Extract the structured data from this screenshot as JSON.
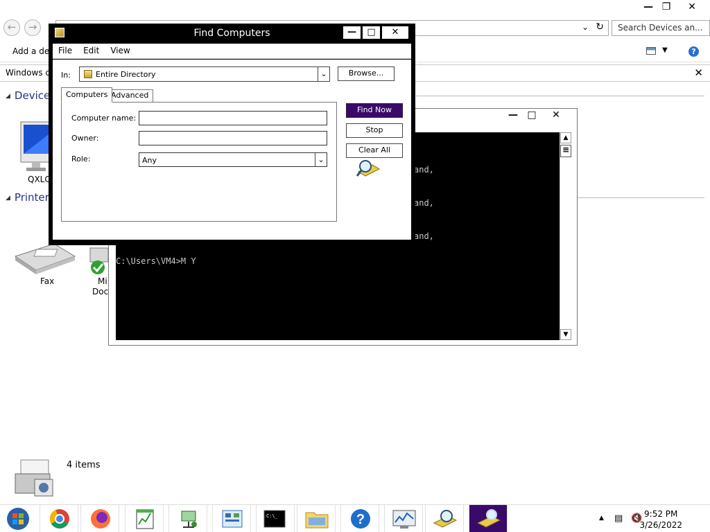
{
  "explorer": {
    "address_value": "",
    "search_placeholder": "Search Devices an...",
    "command_label": "Add a dev",
    "info_text": "Windows ca",
    "devices_header": "Devices",
    "printers_header": "Printers",
    "device_label": "QXLC",
    "fax_label": "Fax",
    "printer2_label_line1": "Mi",
    "printer2_label_line2": "Doc",
    "items_count": "4 items"
  },
  "console": {
    "lines": [
      "and,",
      "and,",
      "and,",
      "C:\\Users\\VM4>M Y"
    ]
  },
  "dialog": {
    "title": "Find Computers",
    "menu": [
      "File",
      "Edit",
      "View"
    ],
    "in_label": "In:",
    "in_value": "Entire Directory",
    "browse_label": "Browse...",
    "tabs": [
      "Computers",
      "Advanced"
    ],
    "fields": {
      "computer_name_label": "Computer name:",
      "computer_name_value": "",
      "owner_label": "Owner:",
      "owner_value": "",
      "role_label": "Role:",
      "role_value": "Any"
    },
    "buttons": {
      "find_now": "Find Now",
      "stop": "Stop",
      "clear_all": "Clear All"
    }
  },
  "taskbar": {
    "apps": [
      "start-orb",
      "chrome",
      "firefox",
      "notepad-chart",
      "network-tool",
      "control-panel",
      "command-prompt",
      "file-explorer",
      "help",
      "performance-monitor",
      "find-computers",
      "find-active"
    ],
    "time": "9:52 PM",
    "date": "3/26/2022"
  },
  "colors": {
    "accent": "#3a0a6a",
    "section_header": "#1e3287",
    "console_bg": "#000000"
  }
}
